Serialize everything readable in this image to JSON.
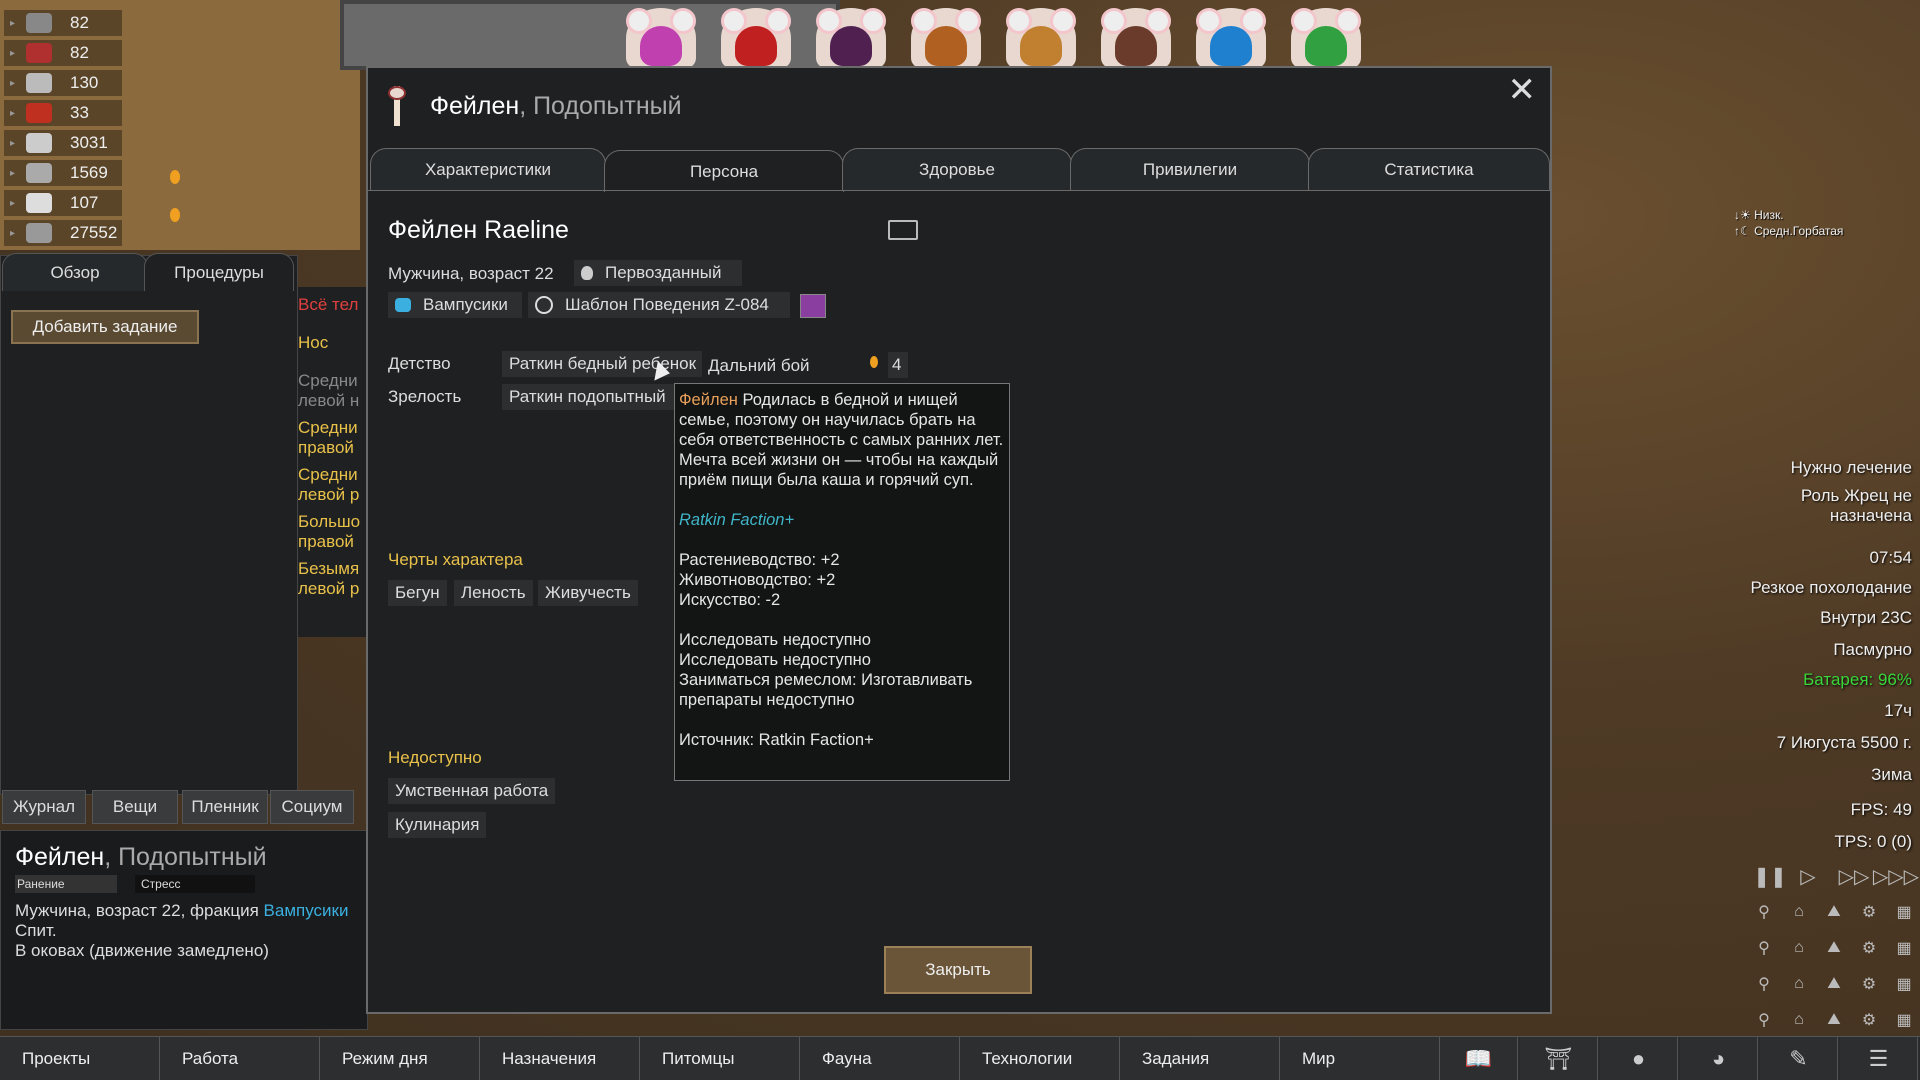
{
  "resources": [
    {
      "value": "82",
      "icon": "stone-icon"
    },
    {
      "value": "82",
      "icon": "books-icon"
    },
    {
      "value": "130",
      "icon": "silver-icon"
    },
    {
      "value": "33",
      "icon": "food-icon"
    },
    {
      "value": "3031",
      "icon": "textile-icon"
    },
    {
      "value": "1569",
      "icon": "steel-icon"
    },
    {
      "value": "107",
      "icon": "medicine-icon"
    },
    {
      "value": "27552",
      "icon": "wood-icon"
    }
  ],
  "portraits": [
    "#c040b0",
    "#c02020",
    "#502050",
    "#b06020",
    "#c08030",
    "#6a3a2a",
    "#2080d0",
    "#30a040"
  ],
  "leftpanel": {
    "tabs": [
      "Обзор",
      "Процедуры"
    ],
    "add_task": "Добавить задание",
    "procedures": [
      {
        "text": "Всё тел",
        "color": "#e04040"
      },
      {
        "text": "Нос",
        "color": "#e8c14a"
      },
      {
        "text": "Средни левой н",
        "color": "#888888"
      },
      {
        "text": "Средни правой",
        "color": "#e8c14a"
      },
      {
        "text": "Средни левой р",
        "color": "#e8c14a"
      },
      {
        "text": "Большо правой",
        "color": "#e8c14a"
      },
      {
        "text": "Безымя левой р",
        "color": "#e8c14a"
      }
    ]
  },
  "bottom_tabs_small": [
    "Журнал",
    "Вещи",
    "Пленник",
    "Социум"
  ],
  "infobox": {
    "name": "Фейлен",
    "title": ", Подопытный",
    "bar1": "Ранение",
    "bar2": "Стресс",
    "line1_prefix": "Мужчина, возраст 22, фракция ",
    "line1_faction": "Вампусики",
    "line2": "Спит.",
    "line3": "В оковах (движение замедлено)"
  },
  "dialog": {
    "name": "Фейлен",
    "title": ", Подопытный",
    "tabs": [
      "Характеристики",
      "Персона",
      "Здоровье",
      "Привилегии",
      "Статистика"
    ],
    "active_tab": "Персона",
    "fullname": "Фейлен Raeline",
    "gender_age": "Мужчина, возраст 22",
    "xenotype": "Первозданный",
    "faction": "Вампусики",
    "ideo": "Шаблон Поведения Z-084",
    "favorite_color": "#8a3fa0",
    "childhood_label": "Детство",
    "childhood_value": "Раткин бедный ребенок",
    "adulthood_label": "Зрелость",
    "adulthood_value": "Раткин подопытный",
    "skill_name": "Дальний бой",
    "skill_value": "4",
    "traits_label": "Черты характера",
    "traits": [
      "Бегун",
      "Леность",
      "Живучесть"
    ],
    "incapable_label": "Недоступно",
    "incapable": [
      "Умственная работа",
      "Кулинария"
    ],
    "close_button": "Закрыть",
    "tooltip": {
      "name": "Фейлен",
      "description": " Родилась в бедной и нищей семье, поэтому он научилась брать на себя ответственность с самых ранних лет. Мечта всей жизни он — чтобы на каждый приём пищи была каша и горячий суп.",
      "mod": "Ratkin Faction+",
      "bonuses": [
        "Растениеводство: +2",
        "Животноводство: +2",
        "Искусство: -2"
      ],
      "disabled": [
        "Исследовать недоступно",
        "Исследовать недоступно",
        "Заниматься ремеслом: Изготавливать препараты недоступно"
      ],
      "source": "Источник: Ratkin Faction+"
    }
  },
  "weather_small": [
    "Низк.",
    "Средн.Горбатая"
  ],
  "right_info": [
    {
      "text": "Нужно лечение",
      "color": "#eeeeee"
    },
    {
      "text": "Роль Жрец не",
      "color": "#eeeeee"
    },
    {
      "text": "назначена",
      "color": "#eeeeee"
    },
    {
      "text": "07:54",
      "color": "#eeeeee"
    },
    {
      "text": "Резкое похолодание",
      "color": "#eeeeee"
    },
    {
      "text": "Внутри 23С",
      "color": "#eeeeee"
    },
    {
      "text": "Пасмурно",
      "color": "#eeeeee"
    },
    {
      "text": "Батарея: 96%",
      "color": "#3ad63a"
    },
    {
      "text": "17ч",
      "color": "#eeeeee"
    },
    {
      "text": "7 Июгуста 5500 г.",
      "color": "#eeeeee"
    },
    {
      "text": "Зима",
      "color": "#eeeeee"
    },
    {
      "text": "FPS: 49",
      "color": "#eeeeee"
    },
    {
      "text": "TPS: 0 (0)",
      "color": "#eeeeee"
    }
  ],
  "bottombar": [
    "Проекты",
    "Работа",
    "Режим дня",
    "Назначения",
    "Питомцы",
    "Фауна",
    "Технологии",
    "Задания",
    "Мир"
  ],
  "bottom_icons": [
    "book-icon",
    "factions-icon",
    "ideas-icon",
    "ideology-icon",
    "blueprint-icon",
    "menu-icon"
  ]
}
